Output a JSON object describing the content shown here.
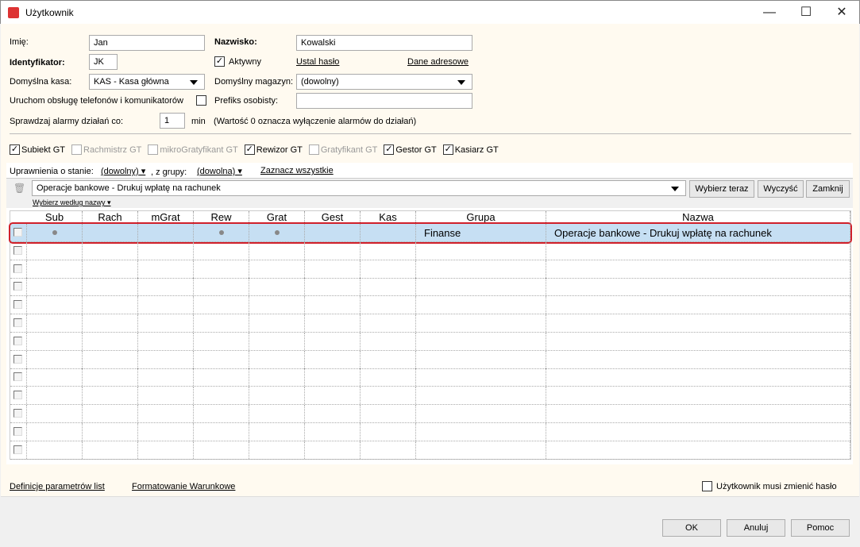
{
  "window": {
    "title": "Użytkownik",
    "logo": "GT"
  },
  "form": {
    "first_name_label": "Imię:",
    "first_name": "Jan",
    "last_name_label": "Nazwisko:",
    "last_name": "Kowalski",
    "id_label": "Identyfikator:",
    "id": "JK",
    "active_label": "Aktywny",
    "active": true,
    "set_password": "Ustal hasło",
    "address_data": "Dane adresowe",
    "cash_label": "Domyślna kasa:",
    "cash": "KAS - Kasa główna",
    "warehouse_label": "Domyślny magazyn:",
    "warehouse": "(dowolny)",
    "phones_label": "Uruchom obsługę telefonów i komunikatorów",
    "phones": false,
    "prefix_label": "Prefiks osobisty:",
    "prefix": "",
    "alarms_label": "Sprawdzaj alarmy działań co:",
    "alarms": "1",
    "alarms_unit": "min",
    "alarms_note": "(Wartość 0 oznacza wyłączenie alarmów do działań)"
  },
  "modules": [
    {
      "label": "Subiekt GT",
      "checked": true,
      "enabled": true
    },
    {
      "label": "Rachmistrz GT",
      "checked": false,
      "enabled": false
    },
    {
      "label": "mikroGratyfikant GT",
      "checked": false,
      "enabled": false
    },
    {
      "label": "Rewizor GT",
      "checked": true,
      "enabled": true
    },
    {
      "label": "Gratyfikant GT",
      "checked": false,
      "enabled": false
    },
    {
      "label": "Gestor GT",
      "checked": true,
      "enabled": true
    },
    {
      "label": "Kasiarz GT",
      "checked": true,
      "enabled": true
    }
  ],
  "filters": {
    "state_label": "Uprawnienia o stanie:",
    "state": "(dowolny)",
    "group_label": ", z grupy:",
    "group": "(dowolna)",
    "select_all": "Zaznacz wszystkie",
    "search": "Operacje bankowe - Drukuj wpłatę na rachunek",
    "choose_now": "Wybierz teraz",
    "clear": "Wyczyść",
    "close": "Zamknij",
    "by_name": "Wybierz według nazwy"
  },
  "grid": {
    "columns": [
      "Sub",
      "Rach",
      "mGrat",
      "Rew",
      "Grat",
      "Gest",
      "Kas",
      "Grupa",
      "Nazwa"
    ],
    "rows": [
      {
        "selected": true,
        "marks": [
          true,
          false,
          false,
          true,
          true,
          false,
          false
        ],
        "group": "Finanse",
        "name": "Operacje bankowe - Drukuj wpłatę na rachunek"
      }
    ],
    "empty_rows": 12
  },
  "footer": {
    "param_defs": "Definicje parametrów list",
    "cond_format": "Formatowanie Warunkowe",
    "must_change_label": "Użytkownik musi zmienić hasło",
    "must_change": false,
    "ok": "OK",
    "cancel": "Anuluj",
    "help": "Pomoc"
  },
  "colors": {
    "selection": "#c6dff3",
    "highlight_border": "#d0202a",
    "background": "#fffaf0"
  }
}
